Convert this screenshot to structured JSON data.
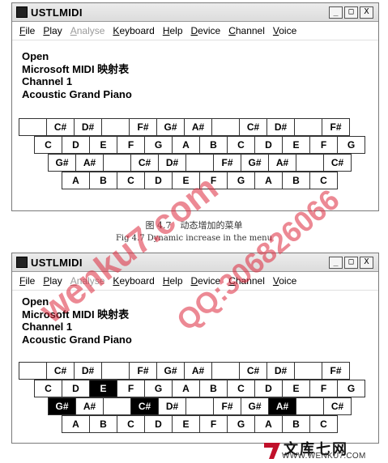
{
  "windows": [
    {
      "title": "USTLMIDI",
      "controls": [
        "_",
        "□",
        "X"
      ],
      "menu": [
        {
          "label": "File",
          "u": "F",
          "disabled": false
        },
        {
          "label": "Play",
          "u": "P",
          "disabled": false
        },
        {
          "label": "Analyse",
          "u": "A",
          "disabled": true
        },
        {
          "label": "Keyboard",
          "u": "K",
          "disabled": false
        },
        {
          "label": "Help",
          "u": "H",
          "disabled": false
        },
        {
          "label": "Device",
          "u": "D",
          "disabled": false
        },
        {
          "label": "Channel",
          "u": "C",
          "disabled": false
        },
        {
          "label": "Voice",
          "u": "V",
          "disabled": false
        }
      ],
      "info": [
        "Open",
        "Microsoft MIDI 映射表",
        "Channel 1",
        "Acoustic Grand Piano"
      ],
      "rows": [
        [
          "",
          "C#",
          "D#",
          "",
          "F#",
          "G#",
          "A#",
          "",
          "C#",
          "D#",
          "",
          "F#"
        ],
        [
          "C",
          "D",
          "E",
          "F",
          "G",
          "A",
          "B",
          "C",
          "D",
          "E",
          "F",
          "G"
        ],
        [
          "G#",
          "A#",
          "",
          "C#",
          "D#",
          "",
          "F#",
          "G#",
          "A#",
          "",
          "C#"
        ],
        [
          "A",
          "B",
          "C",
          "D",
          "E",
          "F",
          "G",
          "A",
          "B",
          "C"
        ]
      ],
      "highlighted": []
    },
    {
      "title": "USTLMIDI",
      "controls": [
        "_",
        "□",
        "X"
      ],
      "menu": [
        {
          "label": "File",
          "u": "F",
          "disabled": false
        },
        {
          "label": "Play",
          "u": "P",
          "disabled": false
        },
        {
          "label": "Analyse",
          "u": "A",
          "disabled": true
        },
        {
          "label": "Keyboard",
          "u": "K",
          "disabled": false
        },
        {
          "label": "Help",
          "u": "H",
          "disabled": false
        },
        {
          "label": "Device",
          "u": "D",
          "disabled": false
        },
        {
          "label": "Channel",
          "u": "C",
          "disabled": false
        },
        {
          "label": "Voice",
          "u": "V",
          "disabled": false
        }
      ],
      "info": [
        "Open",
        "Microsoft MIDI 映射表",
        "Channel 1",
        "Acoustic Grand Piano"
      ],
      "rows": [
        [
          "",
          "C#",
          "D#",
          "",
          "F#",
          "G#",
          "A#",
          "",
          "C#",
          "D#",
          "",
          "F#"
        ],
        [
          "C",
          "D",
          "E",
          "F",
          "G",
          "A",
          "B",
          "C",
          "D",
          "E",
          "F",
          "G"
        ],
        [
          "G#",
          "A#",
          "",
          "C#",
          "D#",
          "",
          "F#",
          "G#",
          "A#",
          "",
          "C#"
        ],
        [
          "A",
          "B",
          "C",
          "D",
          "E",
          "F",
          "G",
          "A",
          "B",
          "C"
        ]
      ],
      "highlighted": [
        "1-2",
        "2-0",
        "2-3",
        "2-8"
      ]
    }
  ],
  "caption_cn": "图 4.7　动态增加的菜单",
  "caption_en": "Fig 4.7  Dynamic increase in the menu",
  "watermark_1": "wenku7.com",
  "watermark_2": "QQ:306826066",
  "logo_text": "文库七网",
  "logo_url": "WWW.WENKU7.COM",
  "colors": {
    "highlight": "#000000",
    "watermark": "#dc283c",
    "logo": "#c0102a"
  }
}
